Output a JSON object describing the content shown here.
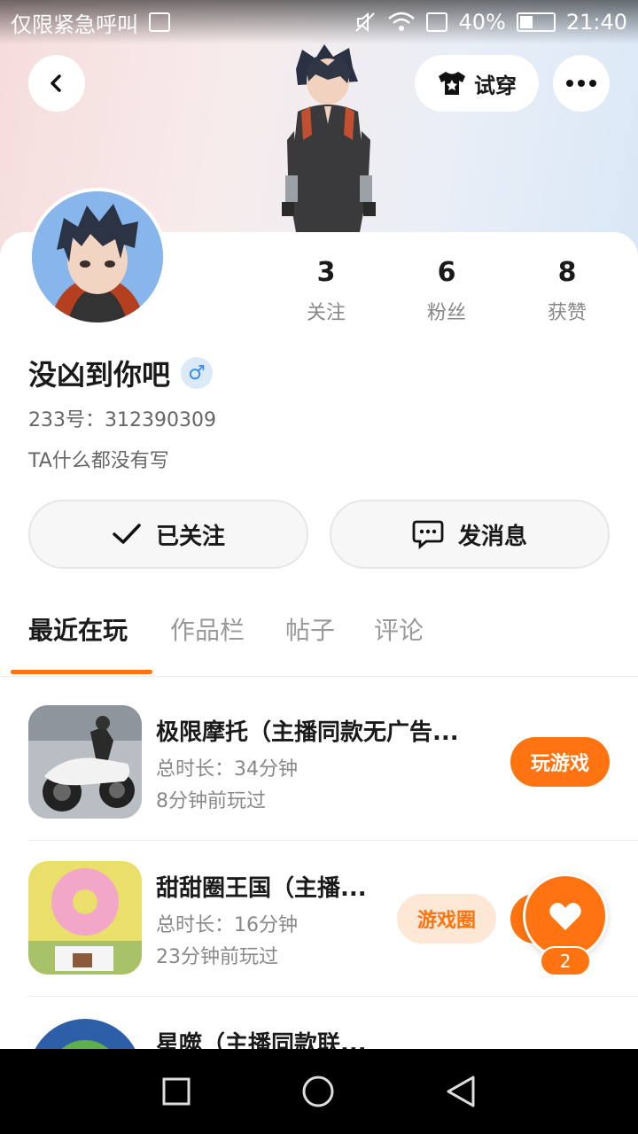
{
  "status_bar": {
    "carrier": "仅限紧急呼叫",
    "battery": "40%",
    "time": "21:40"
  },
  "header": {
    "try_on_label": "试穿"
  },
  "profile": {
    "stats": [
      {
        "value": "3",
        "label": "关注"
      },
      {
        "value": "6",
        "label": "粉丝"
      },
      {
        "value": "8",
        "label": "获赞"
      }
    ],
    "username": "没凶到你吧",
    "gender_symbol": "♂",
    "uid": "233号：312390309",
    "bio": "TA什么都没有写"
  },
  "actions": {
    "followed_label": "已关注",
    "message_label": "发消息"
  },
  "tabs": [
    {
      "label": "最近在玩"
    },
    {
      "label": "作品栏"
    },
    {
      "label": "帖子"
    },
    {
      "label": "评论"
    }
  ],
  "games": [
    {
      "title": "极限摩托（主播同款无广告...",
      "duration": "总时长：34分钟",
      "last_played": "8分钟前玩过",
      "button": "玩游戏"
    },
    {
      "title": "甜甜圈王国（主播...",
      "duration": "总时长：16分钟",
      "last_played": "23分钟前玩过",
      "circle_button": "游戏圈"
    },
    {
      "title": "星噬（主播同款联..."
    }
  ],
  "float_like": {
    "count": "2"
  },
  "colors": {
    "accent": "#ff7410"
  }
}
